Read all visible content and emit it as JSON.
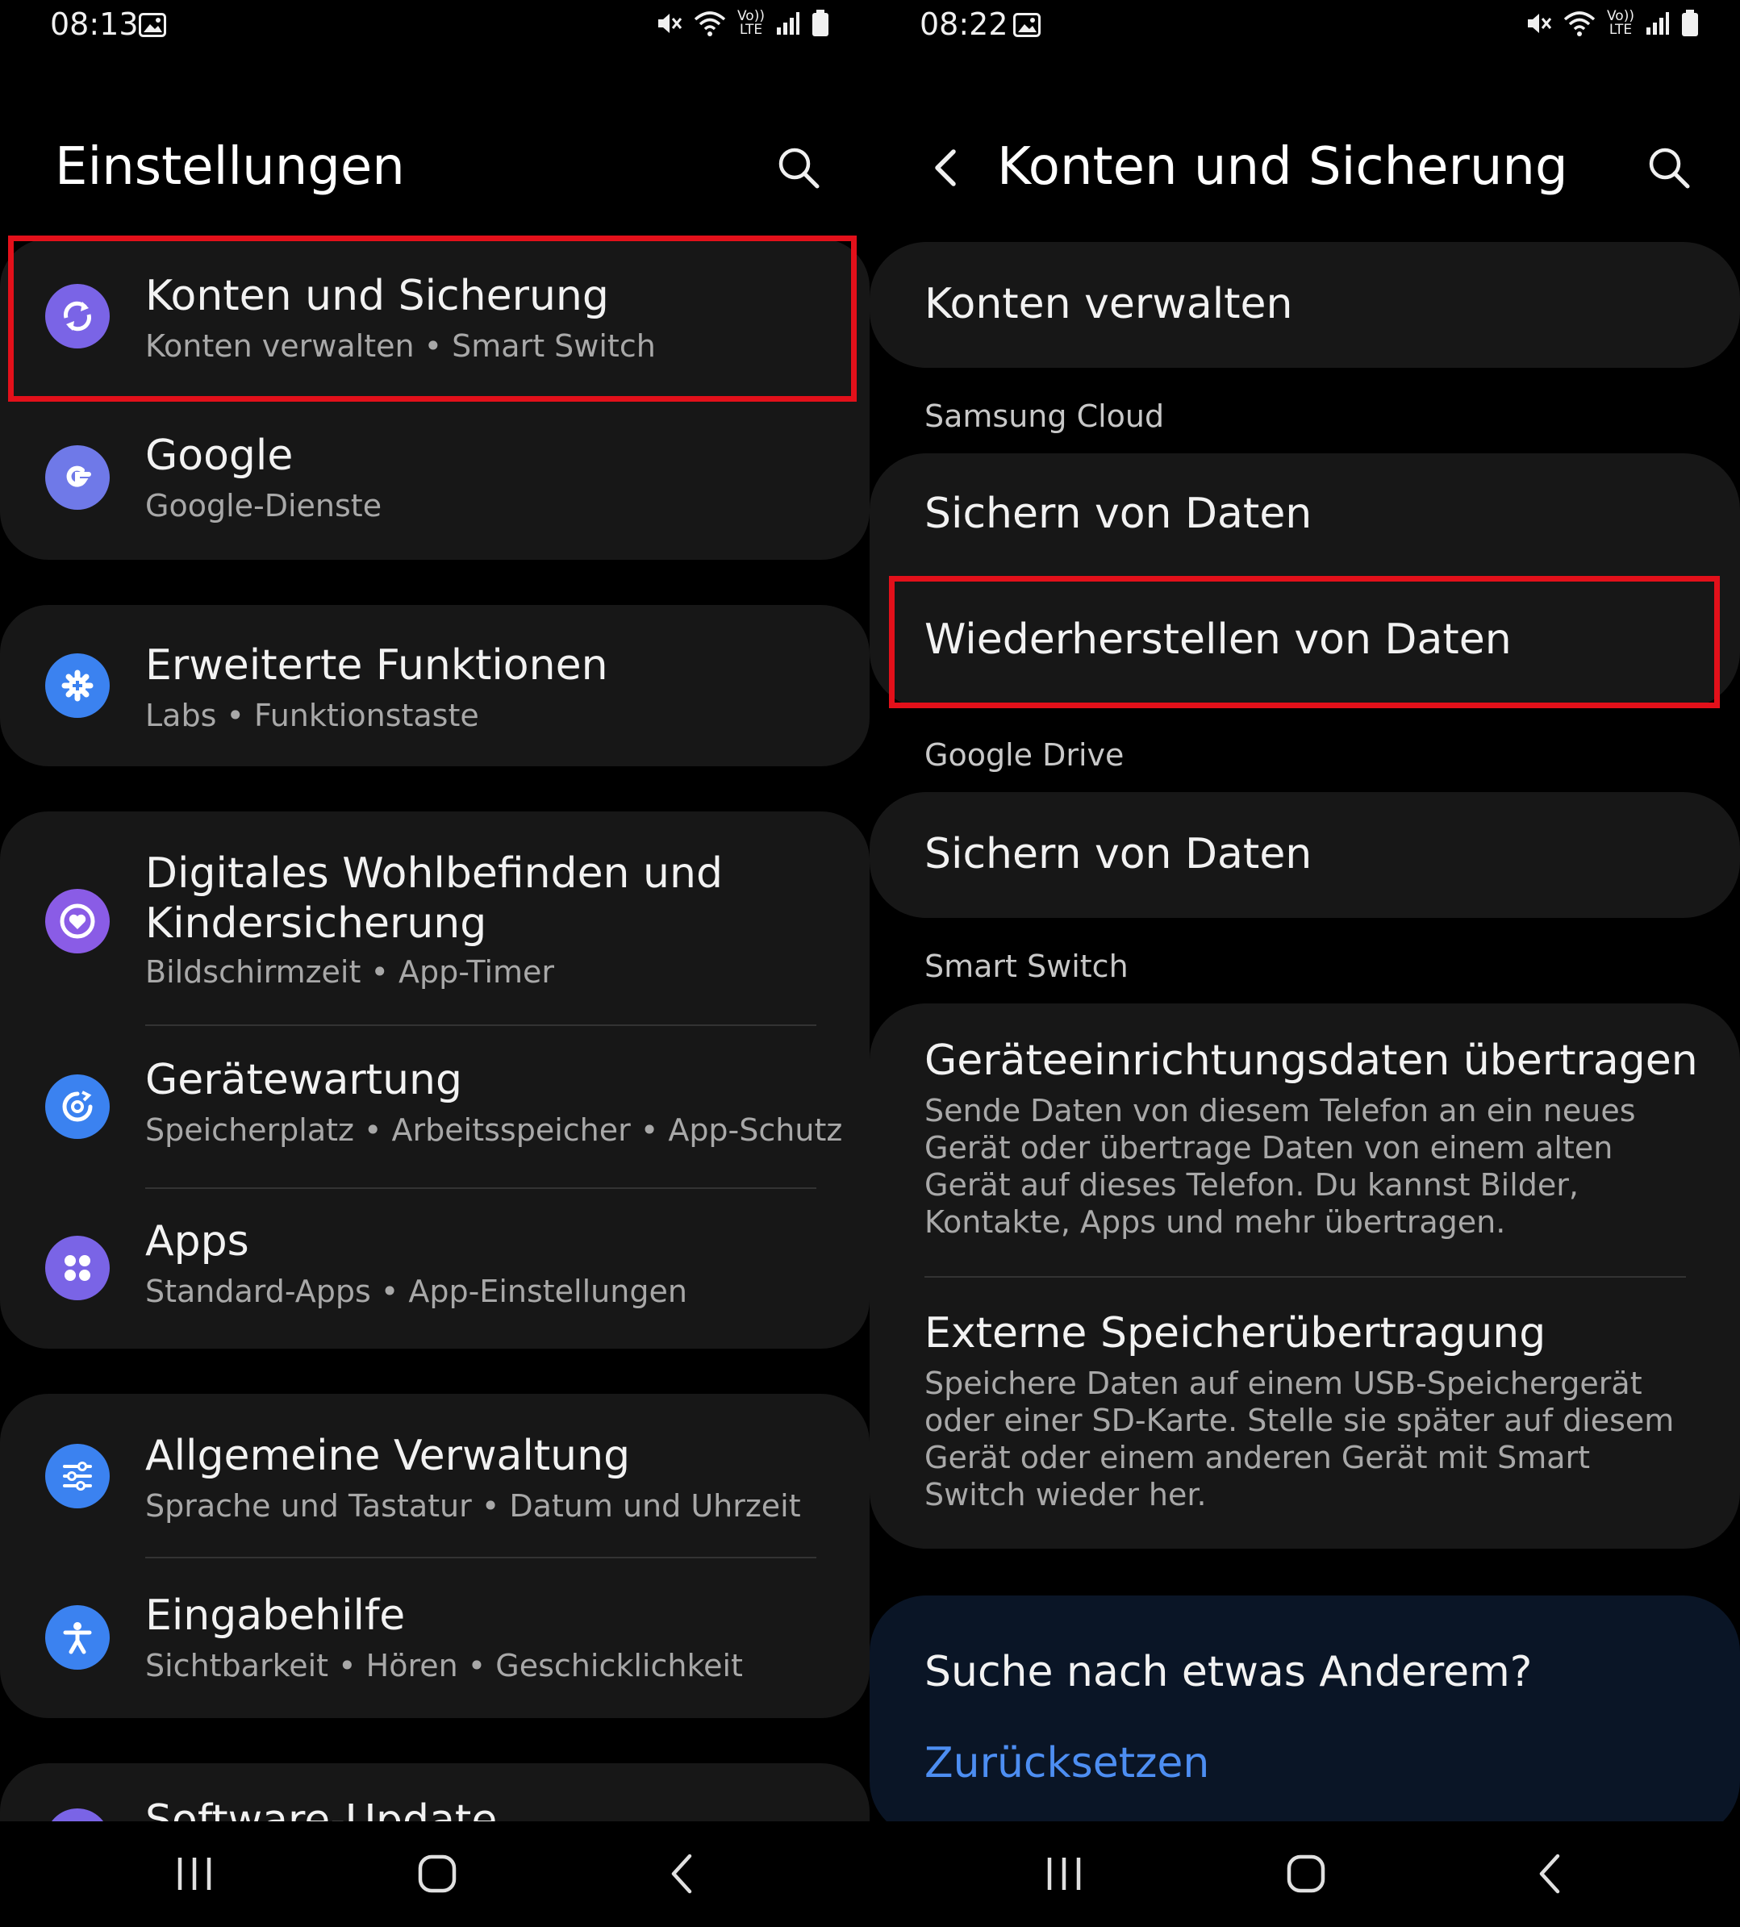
{
  "colors": {
    "background": "#000000",
    "card": "#171717",
    "highlight": "#e3101a",
    "link": "#4d8ef2",
    "suggest_card": "#0a1526"
  },
  "left": {
    "status": {
      "time": "08:13",
      "volte_top": "Vo))",
      "volte_bottom": "LTE"
    },
    "title": "Einstellungen",
    "items": [
      {
        "title": "Konten und Sicherung",
        "subtitle": "Konten verwalten  •  Smart Switch",
        "icon": "sync-icon",
        "icon_color": "#7a64e6"
      },
      {
        "title": "Google",
        "subtitle": "Google-Dienste",
        "icon": "google-g-icon",
        "icon_color": "#6f79e8"
      },
      {
        "title": "Erweiterte Funktionen",
        "subtitle": "Labs  •  Funktionstaste",
        "icon": "puzzle-gear-icon",
        "icon_color": "#3b82f0"
      },
      {
        "title": "Digitales Wohlbefinden und Kindersicherung",
        "title_line1": "Digitales Wohlbefinden und",
        "title_line2": "Kindersicherung",
        "subtitle": "Bildschirmzeit  •  App-Timer",
        "icon": "heart-circle-icon",
        "icon_color": "#8a5ce6"
      },
      {
        "title": "Gerätewartung",
        "subtitle": "Speicherplatz  •  Arbeitsspeicher  •  App-Schutz",
        "icon": "device-care-icon",
        "icon_color": "#3b82f0"
      },
      {
        "title": "Apps",
        "subtitle": "Standard-Apps  •  App-Einstellungen",
        "icon": "apps-grid-icon",
        "icon_color": "#7a64e6"
      },
      {
        "title": "Allgemeine Verwaltung",
        "subtitle": "Sprache und Tastatur  •  Datum und Uhrzeit",
        "icon": "sliders-icon",
        "icon_color": "#3b82f0"
      },
      {
        "title": "Eingabehilfe",
        "subtitle": "Sichtbarkeit  •  Hören  •  Geschicklichkeit",
        "icon": "accessibility-icon",
        "icon_color": "#3b82f0"
      },
      {
        "title": "Software-Update",
        "icon": "software-update-icon",
        "icon_color": "#7a64e6"
      }
    ]
  },
  "right": {
    "status": {
      "time": "08:22",
      "volte_top": "Vo))",
      "volte_bottom": "LTE"
    },
    "title": "Konten und Sicherung",
    "manage_accounts": "Konten verwalten",
    "sections": {
      "samsung_cloud": "Samsung Cloud",
      "google_drive": "Google Drive",
      "smart_switch": "Smart Switch"
    },
    "samsung_backup": "Sichern von Daten",
    "samsung_restore": "Wiederherstellen von Daten",
    "google_backup": "Sichern von Daten",
    "transfer_title": "Geräteeinrichtungsdaten übertragen",
    "transfer_desc": "Sende Daten von diesem Telefon an ein neues Gerät oder übertrage Daten von einem alten Gerät auf dieses Telefon. Du kannst Bilder, Kontakte, Apps und mehr übertragen.",
    "external_title": "Externe Speicherübertragung",
    "external_desc": "Speichere Daten auf einem USB-Speichergerät oder einer SD-Karte. Stelle sie später auf diesem Gerät oder einem anderen Gerät mit Smart Switch wieder her.",
    "suggest_title": "Suche nach etwas Anderem?",
    "suggest_link": "Zurücksetzen"
  }
}
